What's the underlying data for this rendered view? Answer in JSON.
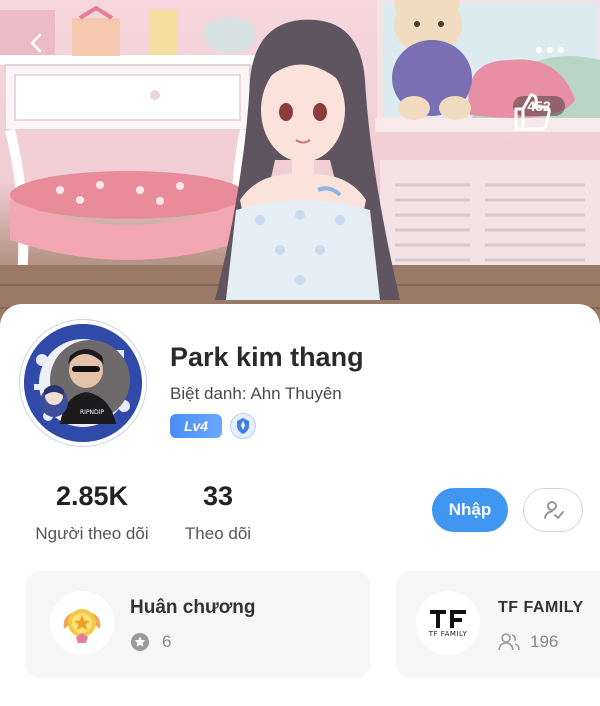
{
  "header": {
    "like_count": "452"
  },
  "profile": {
    "name": "Park kim thang",
    "nickname_label": "Biệt danh:",
    "nickname_value": "Ahn Thuyên",
    "level": "Lv4"
  },
  "stats": {
    "followers_value": "2.85K",
    "followers_label": "Người theo dõi",
    "following_value": "33",
    "following_label": "Theo dõi"
  },
  "actions": {
    "join_label": "Nhập"
  },
  "medal_card": {
    "title": "Huân chương",
    "count": "6"
  },
  "family_card": {
    "title": "TF FAMILY",
    "logo_text": "TF FAMILY",
    "count": "196"
  },
  "colors": {
    "accent_blue": "#3f97f1",
    "level_badge": "#4a8df5",
    "avatar_ring": "#2f4aa8"
  },
  "icons": [
    "back-arrow-icon",
    "more-dots-icon",
    "thumbs-up-icon",
    "verified-badge-icon",
    "add-friend-icon",
    "medal-icon",
    "star-coin-icon",
    "members-icon"
  ]
}
